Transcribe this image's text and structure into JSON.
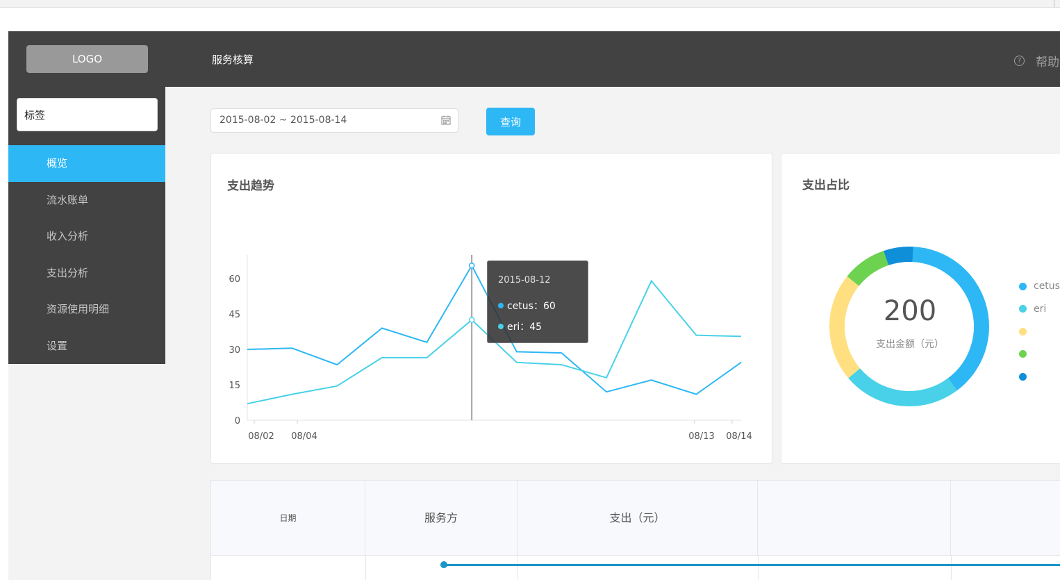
{
  "header": {
    "logo": "LOGO",
    "title": "服务核算",
    "help": "帮助"
  },
  "sidebar": {
    "tag_value": "标签",
    "items": [
      {
        "label": "概览",
        "active": true
      },
      {
        "label": "流水账单"
      },
      {
        "label": "收入分析"
      },
      {
        "label": "支出分析"
      },
      {
        "label": "资源使用明细"
      },
      {
        "label": "设置"
      }
    ]
  },
  "filter": {
    "date_range": "2015-08-02 ~ 2015-08-14",
    "query_label": "查询"
  },
  "trend": {
    "title": "支出趋势",
    "tooltip": {
      "date": "2015-08-12",
      "rows": [
        {
          "label": "cetus：60",
          "color": "#2db7f5"
        },
        {
          "label": "eri：45",
          "color": "#48d1e8"
        }
      ]
    }
  },
  "share": {
    "title": "支出占比",
    "total": "200",
    "caption": "支出金额（元）",
    "legend": [
      {
        "label": "cetus",
        "color": "#2db7f5"
      },
      {
        "label": "eri",
        "color": "#48d1e8"
      },
      {
        "label": "",
        "color": "#ffdf80"
      },
      {
        "label": "",
        "color": "#6dd24f"
      },
      {
        "label": "",
        "color": "#0e8fd8"
      }
    ]
  },
  "table": {
    "headers": [
      "日期",
      "服务方",
      "支出（元）",
      "",
      ""
    ]
  },
  "chart_data": [
    {
      "type": "line",
      "title": "支出趋势",
      "x_ticks": [
        "08/02",
        "08/04",
        "08/13",
        "08/14"
      ],
      "y_ticks": [
        0,
        15,
        30,
        45,
        60
      ],
      "ylim": [
        0,
        70
      ],
      "x_count": 12,
      "series": [
        {
          "name": "cetus",
          "color": "#2db7f5",
          "values": [
            30,
            30.5,
            23.5,
            39,
            33,
            65.5,
            29,
            28.5,
            12,
            17,
            11,
            24.5
          ]
        },
        {
          "name": "eri",
          "color": "#48d1e8",
          "values": [
            7,
            11,
            14.5,
            26.5,
            26.5,
            42.5,
            24.5,
            23.5,
            18,
            59,
            36,
            35.5
          ]
        }
      ],
      "highlight_index": 5
    },
    {
      "type": "pie",
      "title": "支出占比",
      "slices": [
        {
          "name": "cetus",
          "value": 39,
          "color": "#2db7f5"
        },
        {
          "name": "eri",
          "value": 24,
          "color": "#48d1e8"
        },
        {
          "name": "",
          "value": 22,
          "color": "#ffdf80"
        },
        {
          "name": "",
          "value": 9,
          "color": "#6dd24f"
        },
        {
          "name": "",
          "value": 6,
          "color": "#0e8fd8"
        }
      ]
    }
  ]
}
